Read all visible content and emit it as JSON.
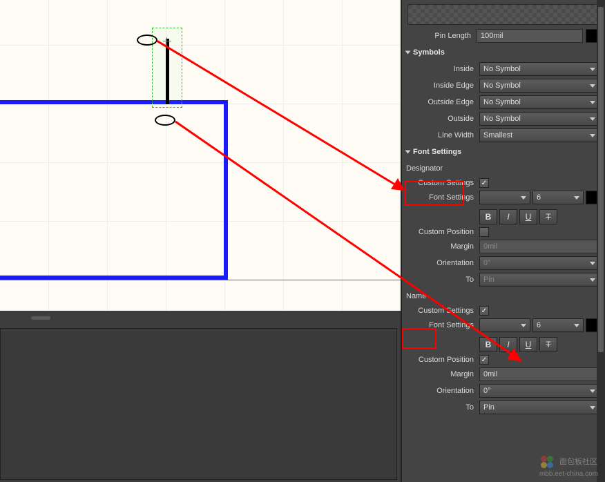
{
  "pin": {
    "length_label": "Pin Length",
    "length_value": "100mil"
  },
  "symbols": {
    "header": "Symbols",
    "inside_label": "Inside",
    "inside_value": "No Symbol",
    "inside_edge_label": "Inside Edge",
    "inside_edge_value": "No Symbol",
    "outside_edge_label": "Outside Edge",
    "outside_edge_value": "No Symbol",
    "outside_label": "Outside",
    "outside_value": "No Symbol",
    "line_width_label": "Line Width",
    "line_width_value": "Smallest"
  },
  "font_settings": {
    "header": "Font Settings",
    "designator": {
      "title": "Designator",
      "custom_settings_label": "Custom Settings",
      "custom_settings": true,
      "font_settings_label": "Font Settings",
      "font_size": "6",
      "bold": "B",
      "italic": "I",
      "underline": "U",
      "strike": "T",
      "custom_position_label": "Custom Position",
      "custom_position": false,
      "margin_label": "Margin",
      "margin_value": "0mil",
      "orientation_label": "Orientation",
      "orientation_value": "0°",
      "to_label": "To",
      "to_value": "Pin"
    },
    "name": {
      "title": "Name",
      "custom_settings_label": "Custom Settings",
      "custom_settings": true,
      "font_settings_label": "Font Settings",
      "font_size": "6",
      "bold": "B",
      "italic": "I",
      "underline": "U",
      "strike": "T",
      "custom_position_label": "Custom Position",
      "custom_position": true,
      "margin_label": "Margin",
      "margin_value": "0mil",
      "orientation_label": "Orientation",
      "orientation_value": "0°",
      "to_label": "To",
      "to_value": "Pin"
    }
  },
  "watermark": {
    "text": "面包板社区",
    "url": "mbb.eet-china.com"
  }
}
